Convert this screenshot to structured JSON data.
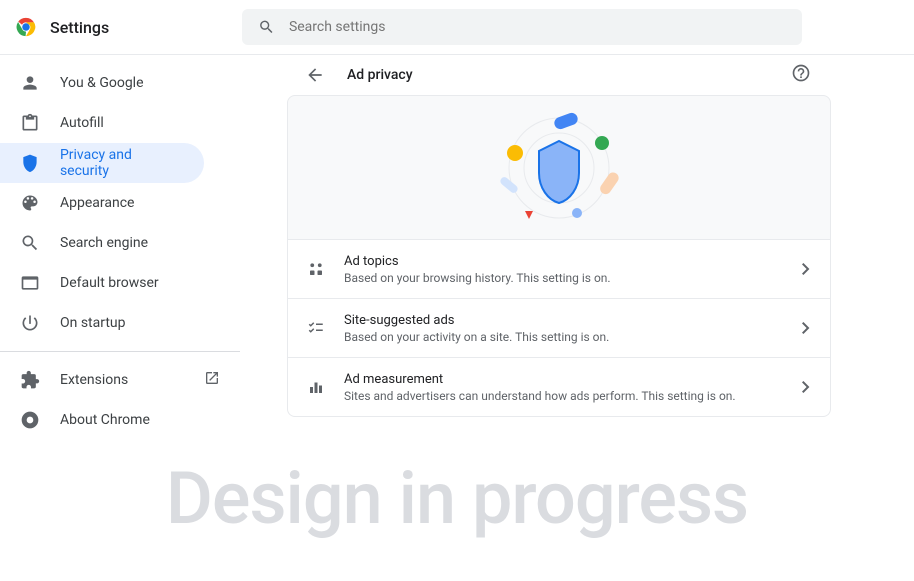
{
  "app": {
    "title": "Settings"
  },
  "search": {
    "placeholder": "Search settings"
  },
  "sidebar": {
    "items": [
      {
        "label": "You & Google"
      },
      {
        "label": "Autofill"
      },
      {
        "label": "Privacy and security"
      },
      {
        "label": "Appearance"
      },
      {
        "label": "Search engine"
      },
      {
        "label": "Default browser"
      },
      {
        "label": "On startup"
      }
    ],
    "extensions": "Extensions",
    "about": "About Chrome"
  },
  "page": {
    "title": "Ad privacy",
    "options": [
      {
        "title": "Ad topics",
        "desc": "Based on your browsing history. This setting is on."
      },
      {
        "title": "Site-suggested ads",
        "desc": "Based on your activity on a site. This setting is on."
      },
      {
        "title": "Ad measurement",
        "desc": "Sites and advertisers can understand how ads perform. This setting is on."
      }
    ]
  },
  "watermark": "Design in progress"
}
